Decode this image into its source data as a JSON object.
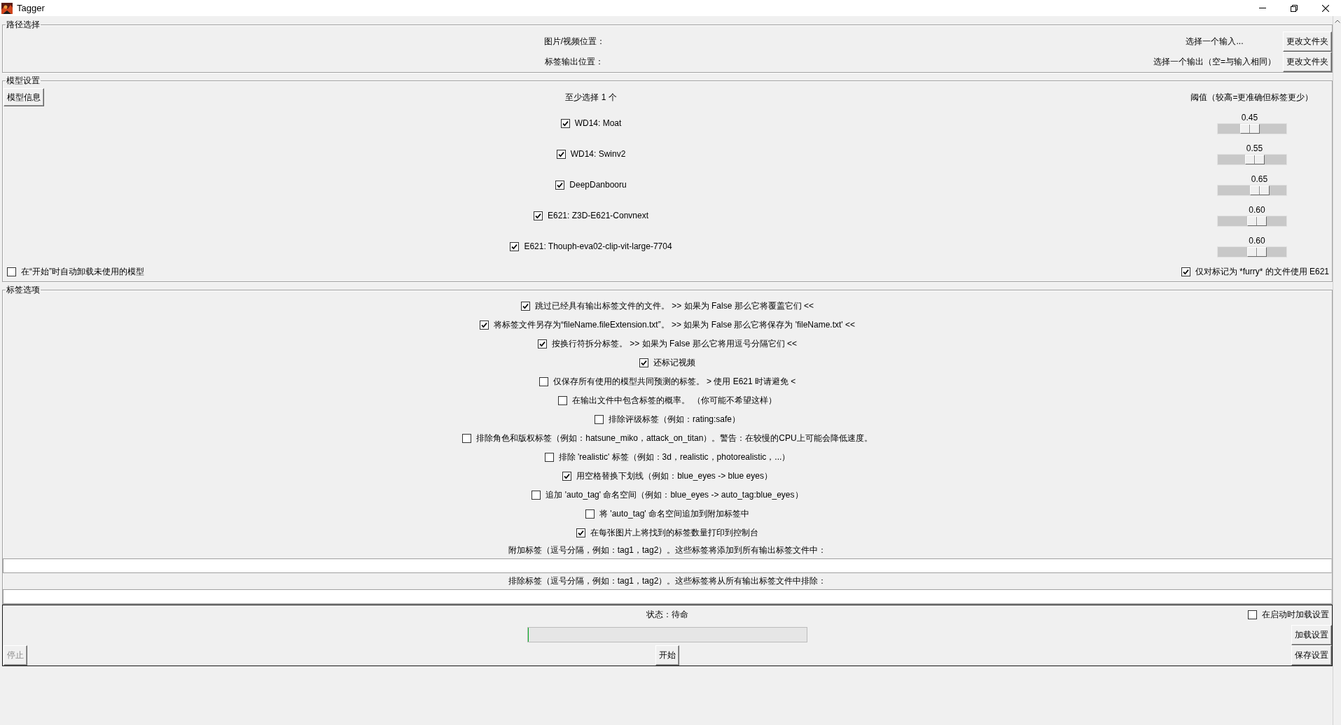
{
  "window": {
    "title": "Tagger"
  },
  "path_selection": {
    "title": "路径选择",
    "rows": [
      {
        "label": "图片/视频位置：",
        "value": "选择一个输入...",
        "button": "更改文件夹"
      },
      {
        "label": "标签输出位置：",
        "value": "选择一个输出（空=与输入相同）",
        "button": "更改文件夹"
      }
    ]
  },
  "model_settings": {
    "title": "模型设置",
    "info_button": "模型信息",
    "models_heading": "至少选择 1 个",
    "threshold_heading": "阈值（较高=更准确但标签更少）",
    "models": [
      {
        "name": "WD14: Moat",
        "checked": true,
        "threshold": "0.45",
        "level": 0.45
      },
      {
        "name": "WD14: Swinv2",
        "checked": true,
        "threshold": "0.55",
        "level": 0.55
      },
      {
        "name": "DeepDanbooru",
        "checked": true,
        "threshold": "0.65",
        "level": 0.65
      },
      {
        "name": "E621: Z3D-E621-Convnext",
        "checked": true,
        "threshold": "0.60",
        "level": 0.6
      },
      {
        "name": "E621: Thouph-eva02-clip-vit-large-7704",
        "checked": true,
        "threshold": "0.60",
        "level": 0.6
      }
    ],
    "unload_unused": {
      "label": "在“开始”时自动卸载未使用的模型",
      "checked": false
    },
    "e621_furry_only": {
      "label": "仅对标记为 *furry* 的文件使用 E621",
      "checked": true
    }
  },
  "tag_options": {
    "title": "标签选项",
    "options": [
      {
        "label": "跳过已经具有输出标签文件的文件。 >> 如果为 False 那么它将覆盖它们 <<",
        "checked": true
      },
      {
        "label": "将标签文件另存为“fileName.fileExtension.txt”。 >> 如果为 False 那么它将保存为 'fileName.txt' <<",
        "checked": true
      },
      {
        "label": "按换行符拆分标签。 >> 如果为 False 那么它将用逗号分隔它们 <<",
        "checked": true
      },
      {
        "label": "还标记视频",
        "checked": true
      },
      {
        "label": "仅保存所有使用的模型共同预测的标签。 > 使用 E621 时请避免 <",
        "checked": false
      },
      {
        "label": "在输出文件中包含标签的概率。 （你可能不希望这样）",
        "checked": false
      },
      {
        "label": "排除评级标签（例如：rating:safe）",
        "checked": false
      },
      {
        "label": "排除角色和版权标签（例如：hatsune_miko，attack_on_titan）。警告：在较慢的CPU上可能会降低速度。",
        "checked": false
      },
      {
        "label": "排除 'realistic' 标签（例如：3d，realistic，photorealistic，...）",
        "checked": false
      },
      {
        "label": "用空格替换下划线（例如：blue_eyes -> blue eyes）",
        "checked": true
      },
      {
        "label": "追加 'auto_tag' 命名空间（例如：blue_eyes -> auto_tag:blue_eyes）",
        "checked": false
      },
      {
        "label": "将 'auto_tag' 命名空间追加到附加标签中",
        "checked": false
      },
      {
        "label": "在每张图片上将找到的标签数量打印到控制台",
        "checked": true
      }
    ],
    "additional_tags": {
      "label": "附加标签（逗号分隔，例如：tag1，tag2）。这些标签将添加到所有输出标签文件中："
    },
    "excluded_tags": {
      "label": "排除标签（逗号分隔，例如：tag1，tag2）。这些标签将从所有输出标签文件中排除："
    }
  },
  "run_panel": {
    "status": "状态：待命",
    "load_on_startup": {
      "label": "在启动时加载设置",
      "checked": false
    },
    "progress": {
      "level": 0
    },
    "load_button": "加载设置",
    "stop_button": {
      "label": "停止",
      "disabled": true
    },
    "start_button": {
      "label": "开始",
      "disabled": false
    },
    "save_button": "保存设置"
  }
}
